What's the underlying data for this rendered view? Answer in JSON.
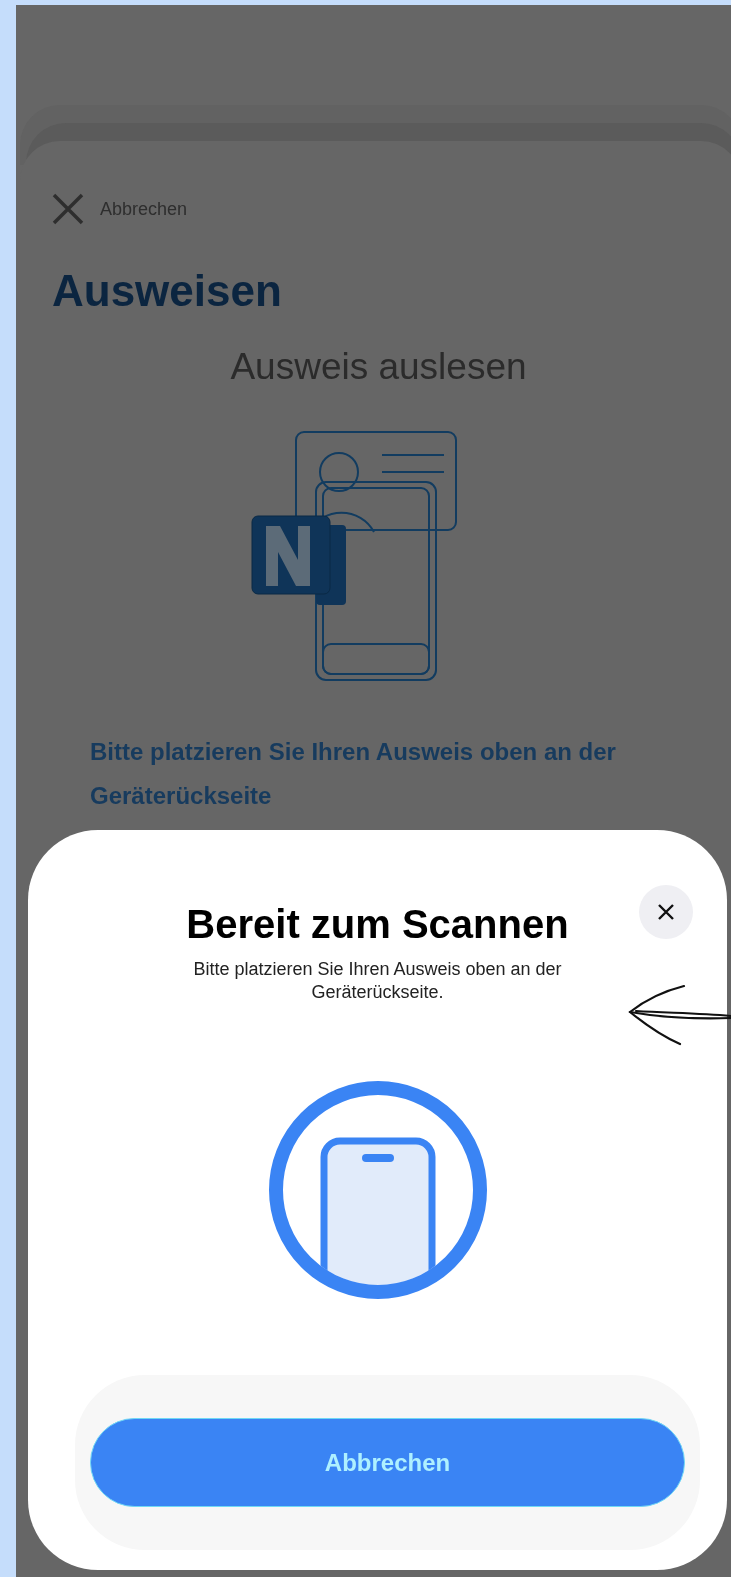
{
  "background_screen": {
    "cancel_link": "Abbrechen",
    "title": "Ausweisen",
    "subtitle": "Ausweis auslesen",
    "instruction": "Bitte platzieren Sie Ihren Ausweis oben an der Geräterückseite"
  },
  "scan_sheet": {
    "title": "Bereit zum Scannen",
    "message": "Bitte platzieren Sie Ihren Ausweis oben an der Geräterückseite.",
    "cancel_button": "Abbrechen"
  }
}
